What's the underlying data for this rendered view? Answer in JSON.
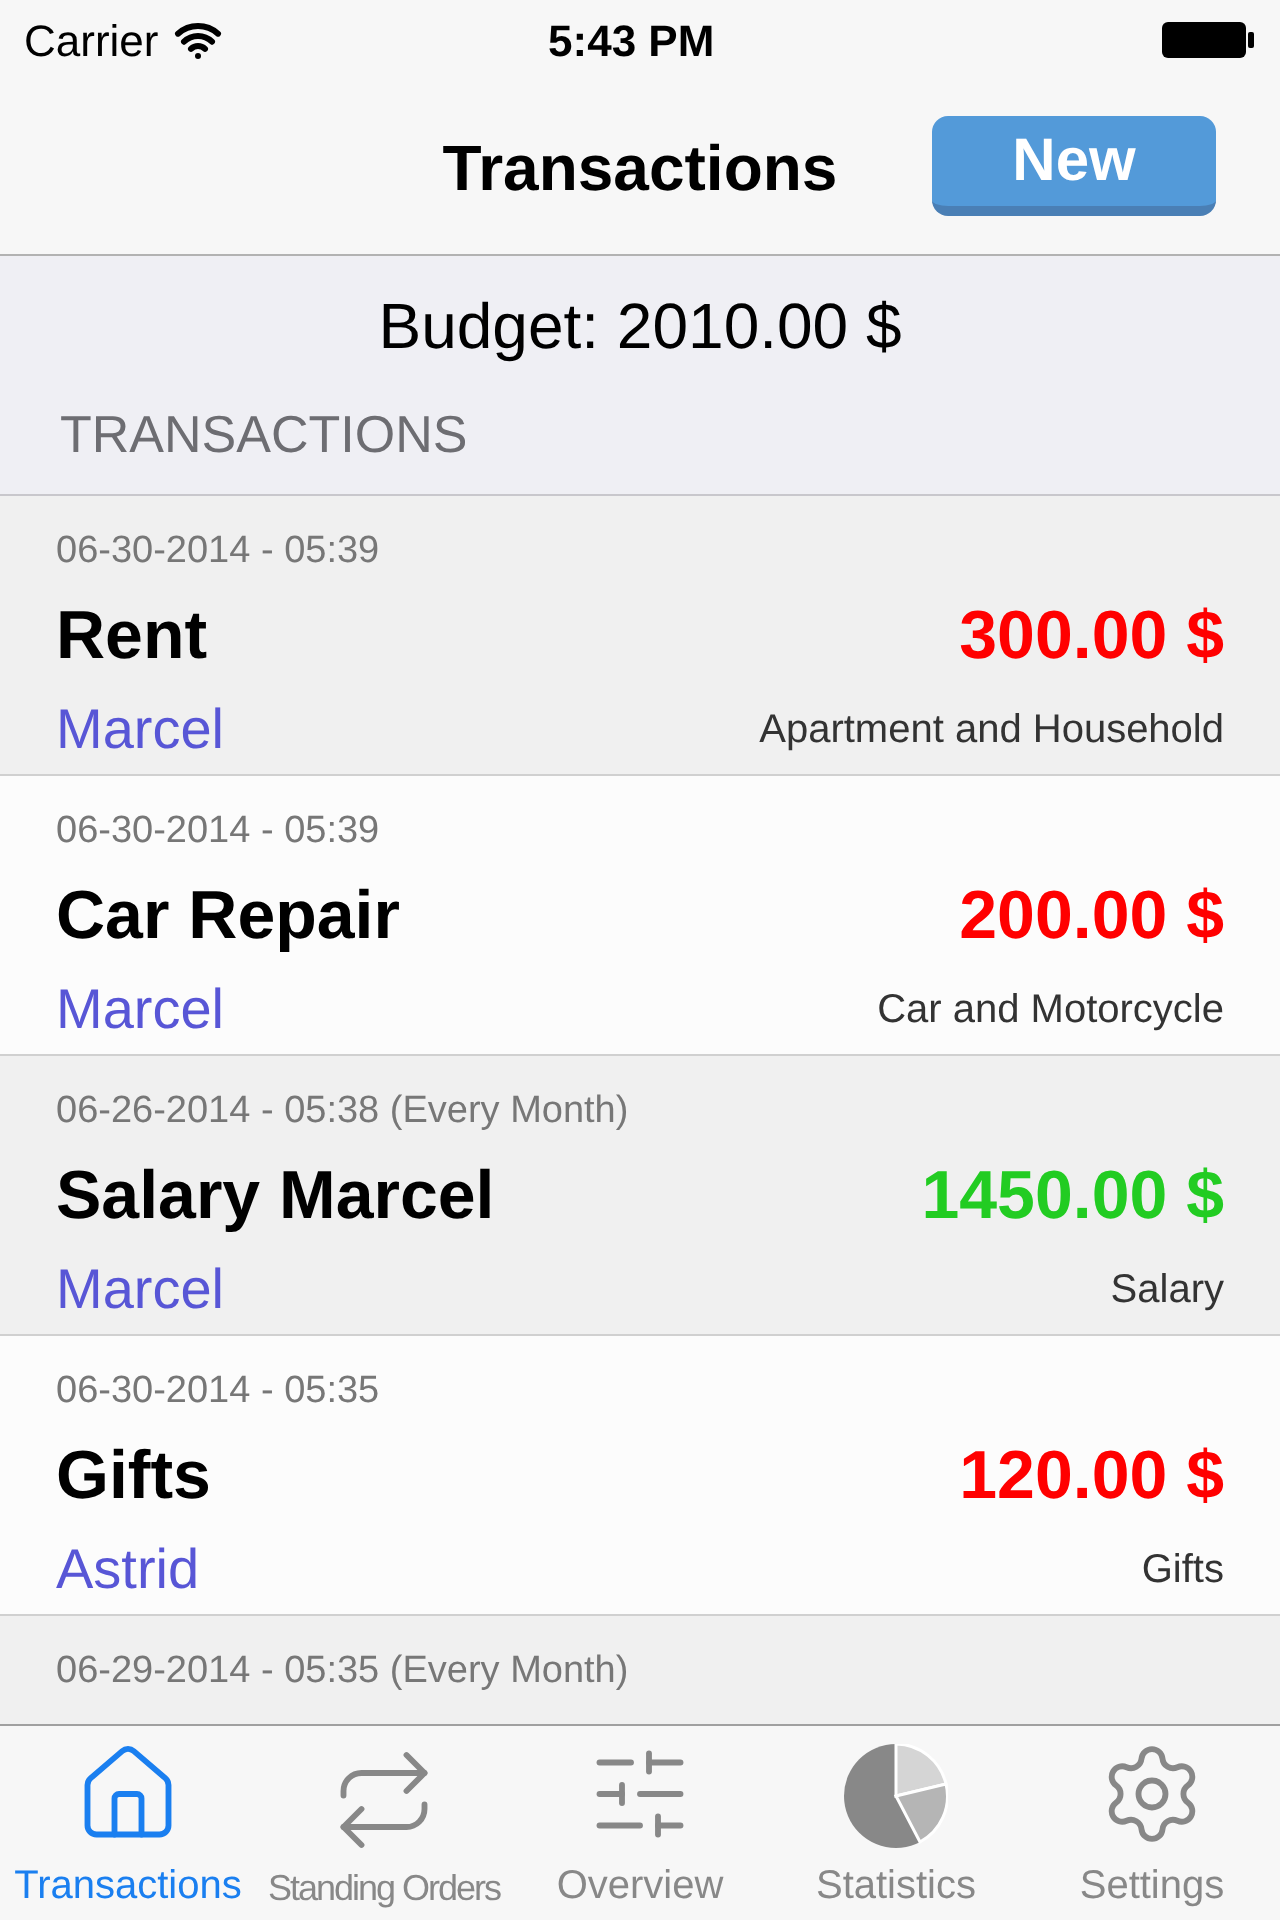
{
  "status_bar": {
    "carrier": "Carrier",
    "time": "5:43 PM"
  },
  "nav": {
    "title": "Transactions",
    "new_button": "New"
  },
  "budget": "Budget: 2010.00 $",
  "section_header": "TRANSACTIONS",
  "transactions": [
    {
      "date": "06-30-2014 - 05:39",
      "name": "Rent",
      "amount": "300.00 $",
      "kind": "expense",
      "person": "Marcel",
      "category": "Apartment and Household"
    },
    {
      "date": "06-30-2014 - 05:39",
      "name": "Car Repair",
      "amount": "200.00 $",
      "kind": "expense",
      "person": "Marcel",
      "category": "Car and Motorcycle"
    },
    {
      "date": "06-26-2014 - 05:38 (Every Month)",
      "name": "Salary Marcel",
      "amount": "1450.00 $",
      "kind": "income",
      "person": "Marcel",
      "category": "Salary"
    },
    {
      "date": "06-30-2014 - 05:35",
      "name": "Gifts",
      "amount": "120.00 $",
      "kind": "expense",
      "person": "Astrid",
      "category": "Gifts"
    },
    {
      "date": "06-29-2014 - 05:35 (Every Month)"
    }
  ],
  "tabs": [
    {
      "label": "Transactions",
      "selected": true
    },
    {
      "label": "Standing Orders",
      "selected": false
    },
    {
      "label": "Overview",
      "selected": false
    },
    {
      "label": "Statistics",
      "selected": false
    },
    {
      "label": "Settings",
      "selected": false
    }
  ]
}
